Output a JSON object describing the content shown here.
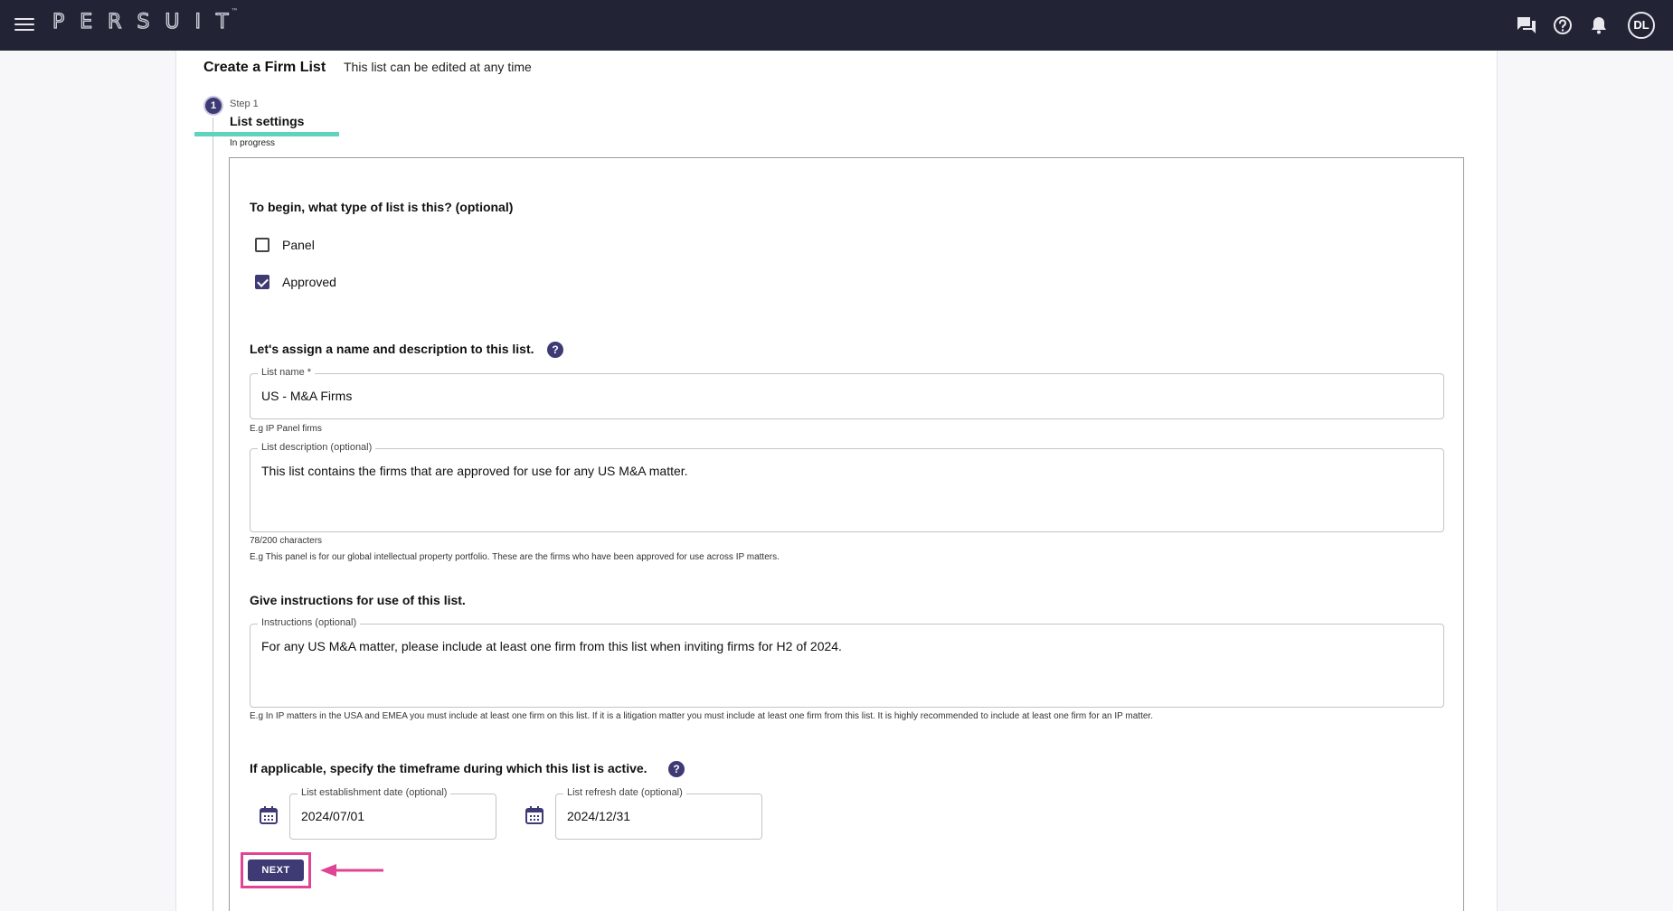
{
  "topbar": {
    "logo_text": "PERSUIT",
    "logo_tm": "™",
    "user_initials": "DL",
    "icons": [
      "menu-icon",
      "chat-icon",
      "help-icon",
      "bell-icon"
    ]
  },
  "page": {
    "title": "Create a Firm List",
    "subtitle": "This list can be edited at any time"
  },
  "step": {
    "number": "1",
    "kicker": "Step 1",
    "title": "List settings",
    "status": "In progress"
  },
  "list_type": {
    "question": "To begin, what type of list is this? (optional)",
    "options": [
      {
        "label": "Panel",
        "checked": false
      },
      {
        "label": "Approved",
        "checked": true
      }
    ]
  },
  "name_section": {
    "question": "Let's assign a name and description to this list.",
    "help": "?",
    "list_name_label": "List name *",
    "list_name_value": "US - M&A Firms",
    "list_name_hint": "E.g IP Panel firms",
    "description_label": "List description (optional)",
    "description_value": "This list contains the firms that are approved for use for any US M&A matter.",
    "description_count": "78/200 characters",
    "description_hint": "E.g This panel is for our global intellectual property portfolio. These are the firms who have been approved for use across IP matters."
  },
  "instructions_section": {
    "question": "Give instructions for use of this list.",
    "label": "Instructions (optional)",
    "value": "For any US M&A matter, please include at least one firm from this list when inviting firms for H2 of 2024.",
    "hint": "E.g In IP matters in the USA and EMEA you must include at least one firm on this list. If it is a litigation matter you must include at least one firm from this list. It is highly recommended to include at least one firm for an IP matter."
  },
  "timeframe_section": {
    "question": "If applicable, specify the timeframe during which this list is active.",
    "help": "?",
    "establishment_label": "List establishment date (optional)",
    "establishment_value": "2024/07/01",
    "refresh_label": "List refresh date (optional)",
    "refresh_value": "2024/12/31"
  },
  "actions": {
    "next_label": "NEXT"
  },
  "colors": {
    "topbar": "#222435",
    "primary": "#3e3a74",
    "step_progress": "#5fd3bd",
    "highlight": "#e04494"
  }
}
